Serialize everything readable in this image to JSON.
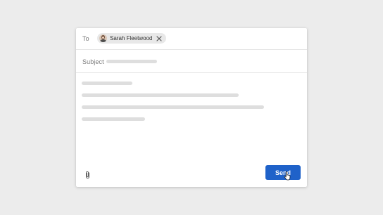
{
  "compose": {
    "to_label": "To",
    "recipient": {
      "name": "Sarah Fleetwood",
      "avatar_icon": "person-avatar",
      "remove_icon": "close-icon"
    },
    "subject_label": "Subject",
    "attach_icon": "paperclip-icon",
    "send_label": "Send"
  },
  "colors": {
    "background": "#ececec",
    "panel": "#ffffff",
    "chip": "#e8e8e8",
    "placeholder_bar": "#dedede",
    "accent": "#1f62c9"
  }
}
